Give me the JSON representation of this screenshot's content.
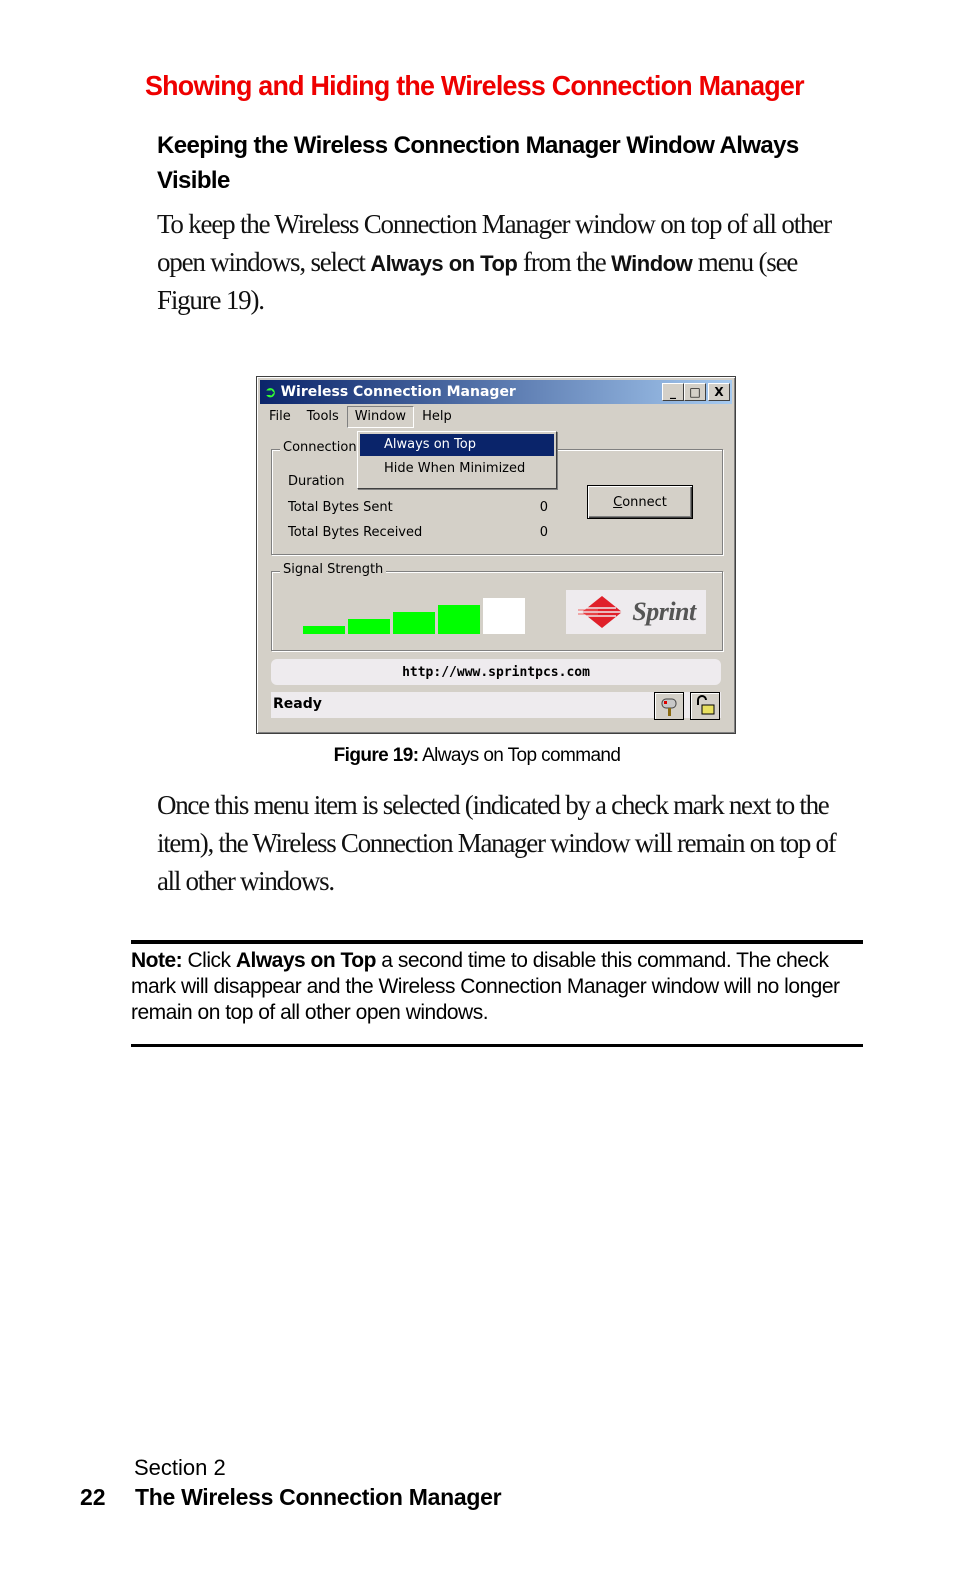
{
  "heading": "Showing and Hiding the Wireless Connection Manager",
  "subheading": "Keeping the Wireless Connection Manager Window Always Visible",
  "intro": {
    "part1": "To keep the Wireless Connection Manager window on top of all other open windows, select ",
    "bold1": "Always on Top",
    "part2": " from the ",
    "bold2": "Window",
    "part3": " menu (see Figure 19)."
  },
  "figure": {
    "window_title": "Wireless Connection Manager",
    "title_buttons": {
      "minimize": "_",
      "maximize": "□",
      "close": "X"
    },
    "menu": [
      "File",
      "Tools",
      "Window",
      "Help"
    ],
    "active_menu": "Window",
    "dropdown": [
      "Always on Top",
      "Hide When Minimized"
    ],
    "selected_dropdown_item": "Always on Top",
    "connection_group_label": "Connection",
    "stats": [
      {
        "label": "Duration",
        "value": ""
      },
      {
        "label": "Total Bytes Sent",
        "value": "0"
      },
      {
        "label": "Total Bytes Received",
        "value": "0"
      }
    ],
    "connect_button": {
      "accesskey": "C",
      "rest": "onnect"
    },
    "signal_group_label": "Signal Strength",
    "signal": {
      "filled_bars": 4,
      "total_bars": 5,
      "filled_color": "#00ff00"
    },
    "logo_text": "Sprint",
    "url": "http://www.sprintpcs.com",
    "status": "Ready",
    "status_icons": [
      "mailbox-icon",
      "unlock-icon"
    ]
  },
  "caption": {
    "label": "Figure 19:",
    "text": " Always on Top command"
  },
  "paragraph2": "Once this menu item is selected (indicated by a check mark next to the item), the Wireless Connection Manager window will remain on top of all other windows.",
  "note": {
    "label": "Note:",
    "part1": " Click ",
    "bold": "Always on Top",
    "part2": " a second time to disable this command. The check mark will disappear and the Wireless Connection Manager window will no longer remain on top of all other open windows."
  },
  "footer": {
    "section": "Section 2",
    "page": "22",
    "chapter": "The Wireless Connection Manager"
  },
  "colors": {
    "heading": "#ee0000",
    "title_bar_start": "#0a246a",
    "title_bar_end": "#a6caf0",
    "menu_highlight": "#0a246a"
  }
}
